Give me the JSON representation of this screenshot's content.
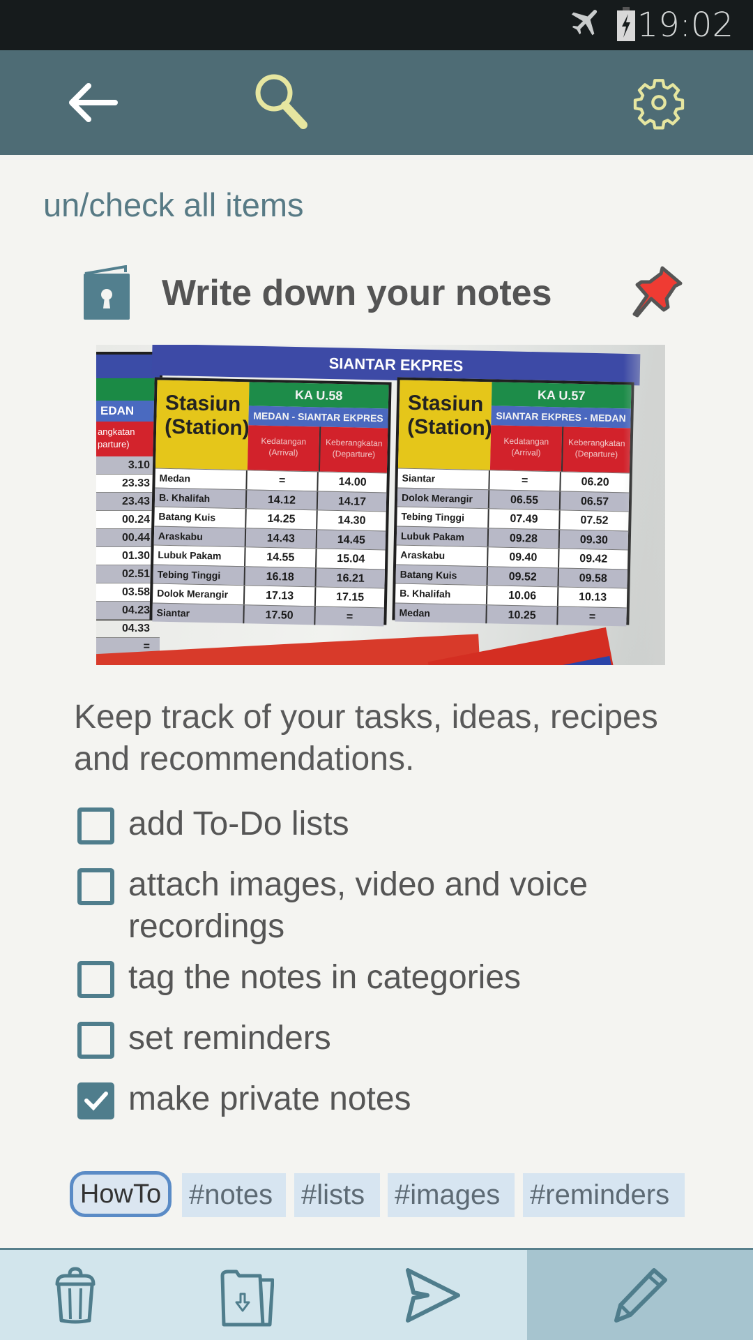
{
  "status_bar": {
    "time": "19:02",
    "icons": [
      "airplane-mode-icon",
      "battery-charging-icon"
    ]
  },
  "toolbar": {
    "back_icon": "arrow-left-icon",
    "search_icon": "search-icon",
    "settings_icon": "gear-icon"
  },
  "note": {
    "uncheck_all_label": "un/check all items",
    "title": "Write down your notes",
    "private_icon": "lock-book-icon",
    "pin_icon": "pushpin-icon",
    "pinned": true,
    "description": "Keep track of your tasks, ideas, recipes and recommendations.",
    "checklist": [
      {
        "label": "add To-Do lists",
        "checked": false
      },
      {
        "label": "attach images, video and voice recordings",
        "checked": false
      },
      {
        "label": "tag the notes in categories",
        "checked": false
      },
      {
        "label": "set reminders",
        "checked": false
      },
      {
        "label": "make private notes",
        "checked": true
      }
    ],
    "category": "HowTo",
    "tags": [
      "#notes",
      "#lists",
      "#images",
      "#reminders"
    ]
  },
  "photo": {
    "banner": "SIANTAR EKPRES",
    "left_fragment": {
      "header": "EDAN",
      "subheader": "angkatan parture)",
      "values": [
        "3.10",
        "23.33",
        "23.43",
        "00.24",
        "00.44",
        "01.30",
        "02.51",
        "03.58",
        "04.23",
        "04.33",
        "="
      ]
    },
    "tables": [
      {
        "station_header": "Stasiun (Station)",
        "train": "KA U.58",
        "route": "MEDAN - SIANTAR EKPRES",
        "arrival_header": "Kedatangan (Arrival)",
        "departure_header": "Keberangkatan (Departure)",
        "rows": [
          {
            "station": "Medan",
            "arrival": "=",
            "departure": "14.00"
          },
          {
            "station": "B. Khalifah",
            "arrival": "14.12",
            "departure": "14.17"
          },
          {
            "station": "Batang Kuis",
            "arrival": "14.25",
            "departure": "14.30"
          },
          {
            "station": "Araskabu",
            "arrival": "14.43",
            "departure": "14.45"
          },
          {
            "station": "Lubuk Pakam",
            "arrival": "14.55",
            "departure": "15.04"
          },
          {
            "station": "Tebing Tinggi",
            "arrival": "16.18",
            "departure": "16.21"
          },
          {
            "station": "Dolok Merangir",
            "arrival": "17.13",
            "departure": "17.15"
          },
          {
            "station": "Siantar",
            "arrival": "17.50",
            "departure": "="
          }
        ]
      },
      {
        "station_header": "Stasiun (Station)",
        "train": "KA U.57",
        "route": "SIANTAR EKPRES - MEDAN",
        "arrival_header": "Kedatangan (Arrival)",
        "departure_header": "Keberangkatan (Departure)",
        "rows": [
          {
            "station": "Siantar",
            "arrival": "=",
            "departure": "06.20"
          },
          {
            "station": "Dolok Merangir",
            "arrival": "06.55",
            "departure": "06.57"
          },
          {
            "station": "Tebing Tinggi",
            "arrival": "07.49",
            "departure": "07.52"
          },
          {
            "station": "Lubuk Pakam",
            "arrival": "09.28",
            "departure": "09.30"
          },
          {
            "station": "Araskabu",
            "arrival": "09.40",
            "departure": "09.42"
          },
          {
            "station": "Batang Kuis",
            "arrival": "09.52",
            "departure": "09.58"
          },
          {
            "station": "B. Khalifah",
            "arrival": "10.06",
            "departure": "10.13"
          },
          {
            "station": "Medan",
            "arrival": "10.25",
            "departure": "="
          }
        ]
      }
    ]
  },
  "bottom_bar": {
    "delete_icon": "trash-icon",
    "archive_icon": "folder-download-icon",
    "send_icon": "send-icon",
    "edit_icon": "pencil-icon"
  },
  "colors": {
    "toolbar": "#4e6c75",
    "status_bar": "#161b1c",
    "accent": "#4f7d8c",
    "toolbar_icon_yellow": "#e6e6a0",
    "pin_red": "#ef3b33",
    "tag_bg": "#d7e5f1",
    "category_border": "#5a8bc6",
    "bottom_bar": "#d2e5ec",
    "edit_button_bg": "#a6c4cf"
  }
}
